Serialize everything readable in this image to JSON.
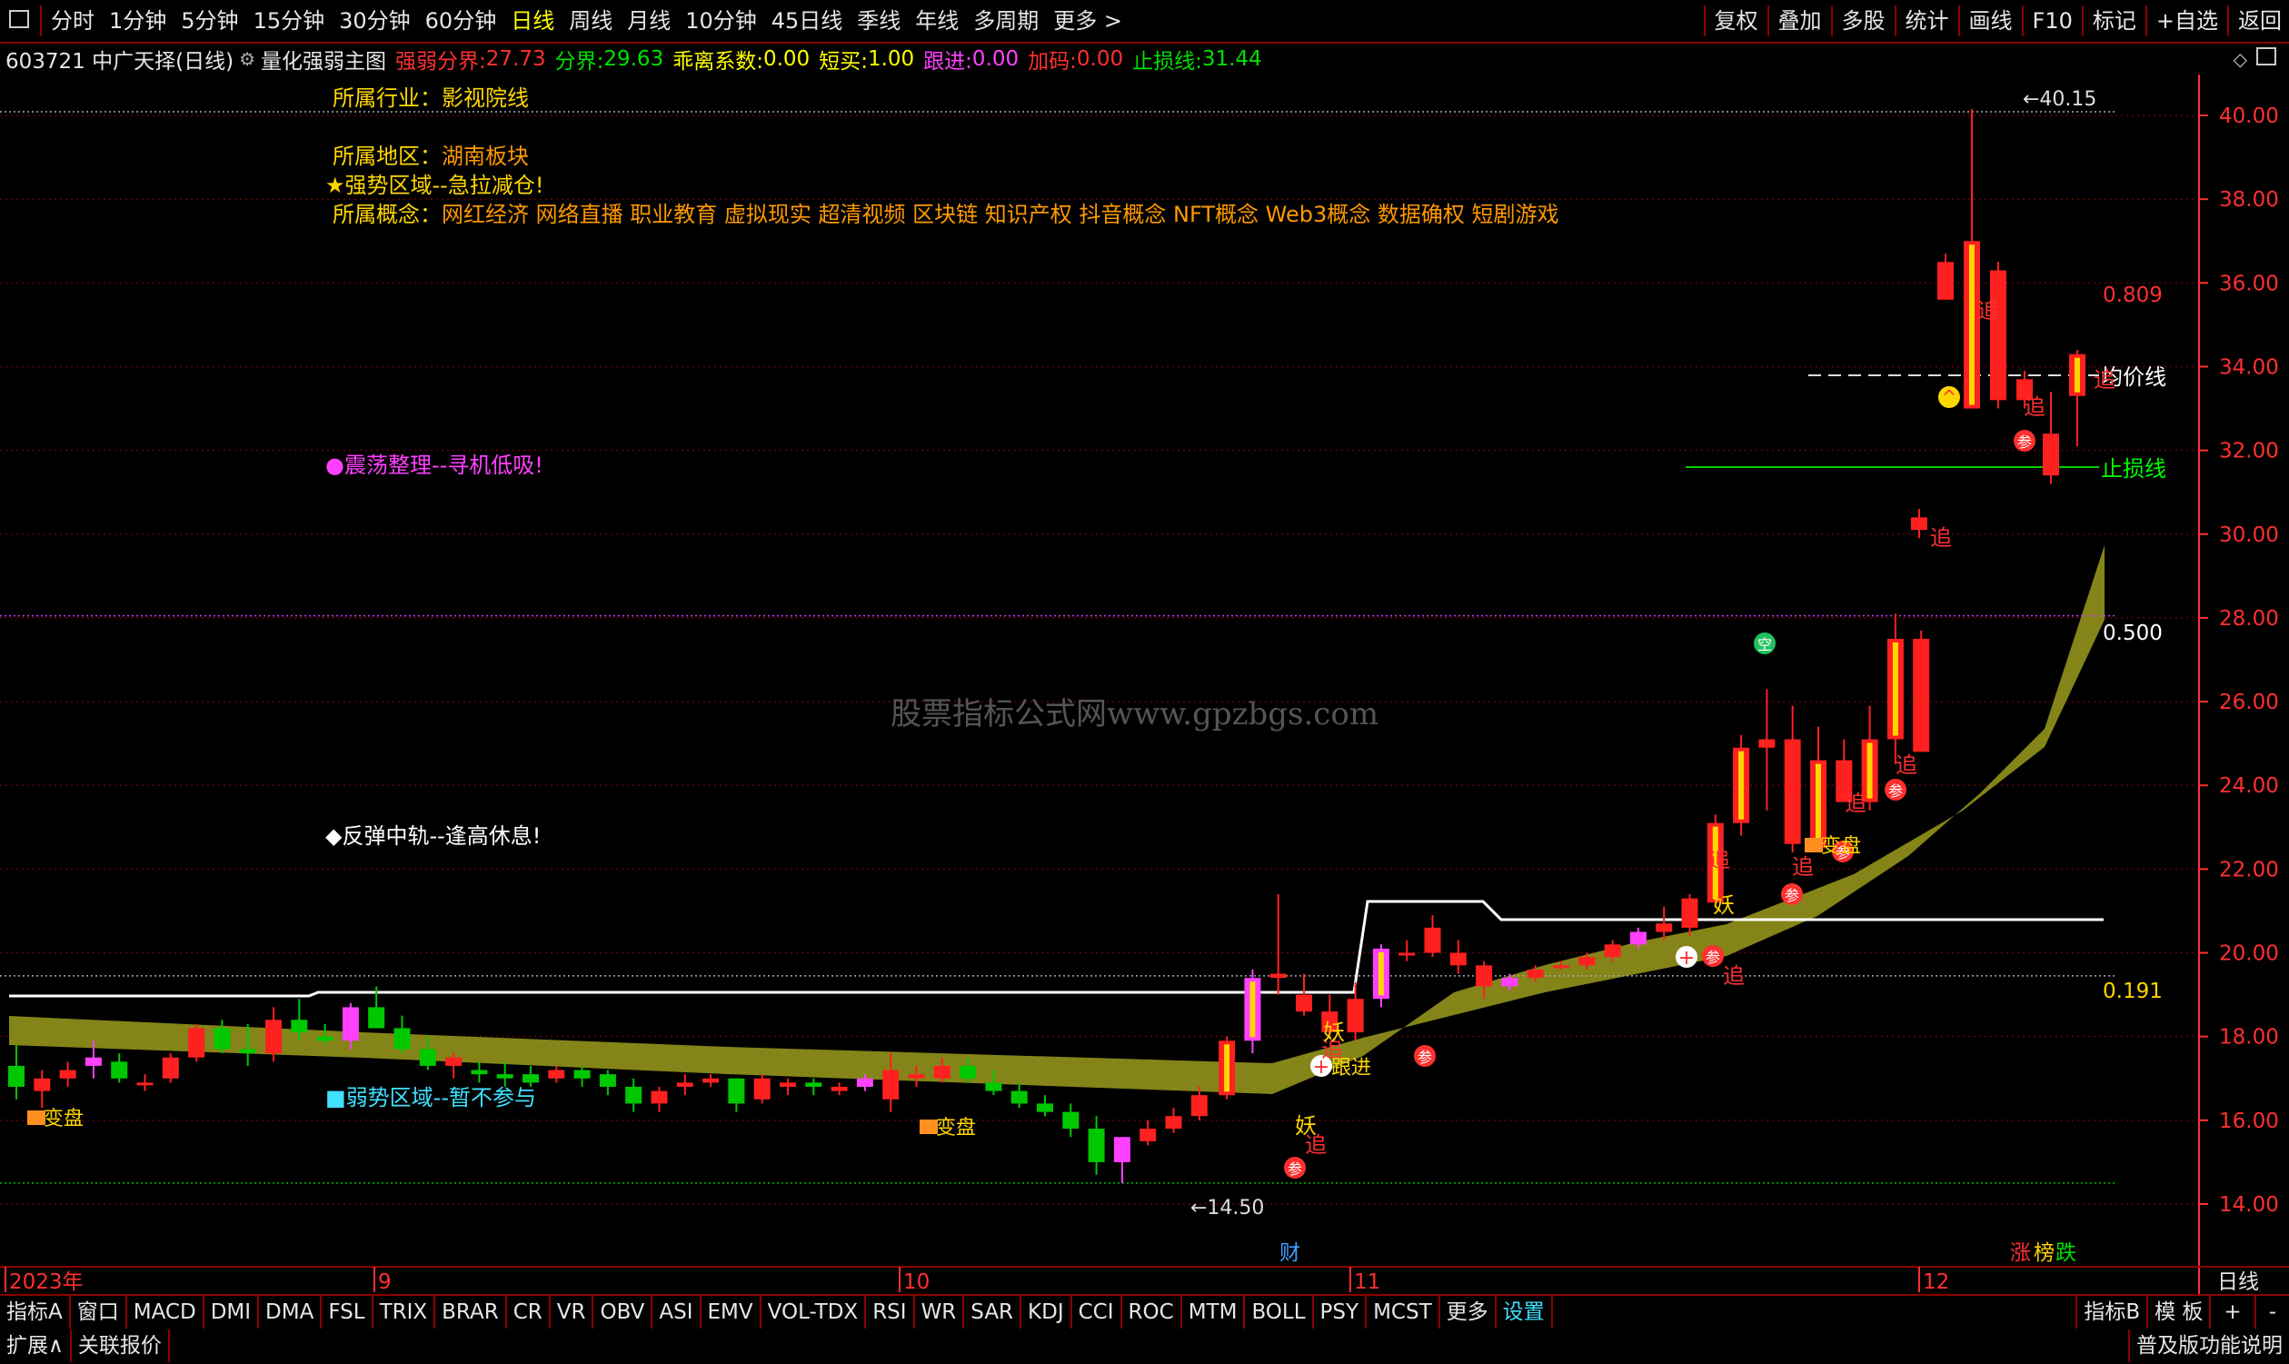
{
  "topbar": {
    "periods": [
      "分时",
      "1分钟",
      "5分钟",
      "15分钟",
      "30分钟",
      "60分钟",
      "日线",
      "周线",
      "月线",
      "10分钟",
      "45日线",
      "季线",
      "年线",
      "多周期",
      "更多 >"
    ],
    "active_period": "日线",
    "tools": [
      "复权",
      "叠加",
      "多股",
      "统计",
      "画线",
      "F10",
      "标记",
      "+自选",
      "返回"
    ]
  },
  "info": {
    "stock": "603721 中广天择(日线)",
    "indicator": "量化强弱主图",
    "ruoqiang_label": "强弱分界:",
    "ruoqiang_val": "27.73",
    "fenjie_label": "分界:",
    "fenjie_val": "29.63",
    "guaili_label": "乖离系数:",
    "guaili_val": "0.00",
    "duanmai_label": "短买:",
    "duanmai_val": "1.00",
    "genjin_label": "跟进:",
    "genjin_val": "0.00",
    "jiama_label": "加码:",
    "jiama_val": "0.00",
    "zhisun_label": "止损线:",
    "zhisun_val": "31.44"
  },
  "annotations": {
    "industry": "所属行业：影视院线",
    "region_label": "所属地区：",
    "region_val": "湖南板块",
    "strong_zone": "★强势区域--急拉减仓!",
    "concept_label": "所属概念：",
    "concept_val": "网红经济 网络直播 职业教育 虚拟现实 超清视频 区块链 知识产权 抖音概念 NFT概念 Web3概念 数据确权 短剧游戏",
    "oscillation": "●震荡整理--寻机低吸!",
    "rebound": "◆反弹中轨--逢高休息!",
    "weak_zone": "■弱势区域--暂不参与",
    "watermark": "股票指标公式网www.gpzbgs.com",
    "high_mark": "40.15",
    "low_mark": "14.50",
    "avg_line": "均价线",
    "stop_line": "止损线",
    "fib_0809": "0.809",
    "fib_0500": "0.500",
    "fib_0191": "0.191",
    "signal_yao": "妖",
    "signal_zhui": "追",
    "signal_can": "参",
    "signal_jin": "跟进",
    "signal_kong": "空",
    "signal_pan": "变盘"
  },
  "y_axis": [
    "40.00",
    "38.00",
    "36.00",
    "34.00",
    "32.00",
    "30.00",
    "28.00",
    "26.00",
    "24.00",
    "22.00",
    "20.00",
    "18.00",
    "16.00",
    "14.00"
  ],
  "x_axis": [
    "2023年",
    "9",
    "10",
    "11",
    "12"
  ],
  "x_markers": {
    "cai": "财",
    "zhang": "涨",
    "bang": "榜",
    "die": "跌"
  },
  "x_right": "日线",
  "indicator_tabs": [
    "指标A",
    "窗口",
    "MACD",
    "DMI",
    "DMA",
    "FSL",
    "TRIX",
    "BRAR",
    "CR",
    "VR",
    "OBV",
    "ASI",
    "EMV",
    "VOL-TDX",
    "RSI",
    "WR",
    "SAR",
    "KDJ",
    "CCI",
    "ROC",
    "MTM",
    "BOLL",
    "PSY",
    "MCST",
    "更多",
    "设置"
  ],
  "indicator_right": [
    "指标B",
    "模 板",
    "+",
    "-"
  ],
  "bottom": {
    "expand": "扩展∧",
    "quote": "关联报价",
    "version": "普及版功能说明"
  },
  "colors": {
    "up": "#ff2020",
    "up_yellow": "#ffd700",
    "down": "#00c800",
    "magenta": "#ff40ff",
    "band": "#8b8b1a",
    "axis": "#ff3030"
  },
  "chart_data": {
    "type": "candlestick",
    "ylim": [
      13.5,
      40.5
    ],
    "candles": [
      [
        17.3,
        17.8,
        16.5,
        16.8
      ],
      [
        16.7,
        17.2,
        16.3,
        17.0
      ],
      [
        17.0,
        17.4,
        16.8,
        17.2
      ],
      [
        17.3,
        17.9,
        17.0,
        17.5
      ],
      [
        17.4,
        17.6,
        16.9,
        17.0
      ],
      [
        16.9,
        17.1,
        16.7,
        16.9
      ],
      [
        17.0,
        17.6,
        16.9,
        17.5
      ],
      [
        17.5,
        18.3,
        17.4,
        18.2
      ],
      [
        18.2,
        18.4,
        17.6,
        17.7
      ],
      [
        17.7,
        18.3,
        17.3,
        17.6
      ],
      [
        17.6,
        18.7,
        17.4,
        18.4
      ],
      [
        18.4,
        18.9,
        17.9,
        18.1
      ],
      [
        18.0,
        18.3,
        17.8,
        17.9
      ],
      [
        17.9,
        18.8,
        17.7,
        18.7
      ],
      [
        18.7,
        19.2,
        18.2,
        18.2
      ],
      [
        18.2,
        18.5,
        17.6,
        17.7
      ],
      [
        17.7,
        18.0,
        17.2,
        17.3
      ],
      [
        17.3,
        17.6,
        17.0,
        17.5
      ],
      [
        17.2,
        17.4,
        16.9,
        17.1
      ],
      [
        17.1,
        17.4,
        16.8,
        17.0
      ],
      [
        17.1,
        17.3,
        16.8,
        16.9
      ],
      [
        17.0,
        17.3,
        16.9,
        17.2
      ],
      [
        17.2,
        17.3,
        16.8,
        17.0
      ],
      [
        17.1,
        17.2,
        16.6,
        16.8
      ],
      [
        16.8,
        17.0,
        16.2,
        16.4
      ],
      [
        16.4,
        16.8,
        16.2,
        16.7
      ],
      [
        16.8,
        17.1,
        16.6,
        16.9
      ],
      [
        16.9,
        17.1,
        16.8,
        17.0
      ],
      [
        17.0,
        17.0,
        16.2,
        16.4
      ],
      [
        16.5,
        17.1,
        16.4,
        17.0
      ],
      [
        16.8,
        17.0,
        16.6,
        16.9
      ],
      [
        16.9,
        17.0,
        16.6,
        16.8
      ],
      [
        16.7,
        16.9,
        16.6,
        16.8
      ],
      [
        16.8,
        17.1,
        16.7,
        17.0
      ],
      [
        16.5,
        17.6,
        16.2,
        17.2
      ],
      [
        17.0,
        17.3,
        16.8,
        17.1
      ],
      [
        17.0,
        17.5,
        16.9,
        17.3
      ],
      [
        17.3,
        17.5,
        16.9,
        17.0
      ],
      [
        16.9,
        17.2,
        16.6,
        16.7
      ],
      [
        16.7,
        16.9,
        16.3,
        16.4
      ],
      [
        16.4,
        16.6,
        16.1,
        16.2
      ],
      [
        16.2,
        16.4,
        15.6,
        15.8
      ],
      [
        15.8,
        16.1,
        14.7,
        15.0
      ],
      [
        15.0,
        15.6,
        14.5,
        15.6
      ],
      [
        15.5,
        16.0,
        15.4,
        15.8
      ],
      [
        15.8,
        16.3,
        15.7,
        16.1
      ],
      [
        16.1,
        16.8,
        16.0,
        16.6
      ],
      [
        16.6,
        18.0,
        16.5,
        17.9
      ],
      [
        17.9,
        19.6,
        17.6,
        19.4
      ],
      [
        19.4,
        21.4,
        19.0,
        19.5
      ],
      [
        19.0,
        19.5,
        18.5,
        18.6
      ],
      [
        18.6,
        19.0,
        18.0,
        18.1
      ],
      [
        18.1,
        19.3,
        17.9,
        18.9
      ],
      [
        18.9,
        20.2,
        18.7,
        20.1
      ],
      [
        20.0,
        20.3,
        19.8,
        20.0
      ],
      [
        20.6,
        20.9,
        19.9,
        20.0
      ],
      [
        20.0,
        20.3,
        19.5,
        19.7
      ],
      [
        19.7,
        19.8,
        18.9,
        19.2
      ],
      [
        19.2,
        19.5,
        19.1,
        19.4
      ],
      [
        19.4,
        19.7,
        19.3,
        19.6
      ],
      [
        19.7,
        19.8,
        19.6,
        19.7
      ],
      [
        19.7,
        20.0,
        19.6,
        19.9
      ],
      [
        19.9,
        20.3,
        19.8,
        20.2
      ],
      [
        20.2,
        20.6,
        20.1,
        20.5
      ],
      [
        20.5,
        21.1,
        20.3,
        20.7
      ],
      [
        20.6,
        21.4,
        20.4,
        21.3
      ],
      [
        21.2,
        23.3,
        21.1,
        23.1
      ],
      [
        23.1,
        25.2,
        22.8,
        24.9
      ],
      [
        24.9,
        26.3,
        23.4,
        25.1
      ],
      [
        25.1,
        25.9,
        22.4,
        22.6
      ],
      [
        22.5,
        25.4,
        22.5,
        24.6
      ],
      [
        24.6,
        25.1,
        23.7,
        23.6
      ],
      [
        23.6,
        25.9,
        23.4,
        25.1
      ],
      [
        25.1,
        28.1,
        24.5,
        27.5
      ],
      [
        27.5,
        27.7,
        24.8,
        24.8
      ],
      [
        30.4,
        30.6,
        29.9,
        30.1
      ],
      [
        36.5,
        36.7,
        35.6,
        35.6
      ],
      [
        33.0,
        40.15,
        33.0,
        37.0
      ],
      [
        36.3,
        36.5,
        33.0,
        33.2
      ],
      [
        33.2,
        33.9,
        33.0,
        33.7
      ],
      [
        32.4,
        33.4,
        31.2,
        31.4
      ],
      [
        33.3,
        34.4,
        32.1,
        34.3
      ]
    ]
  }
}
